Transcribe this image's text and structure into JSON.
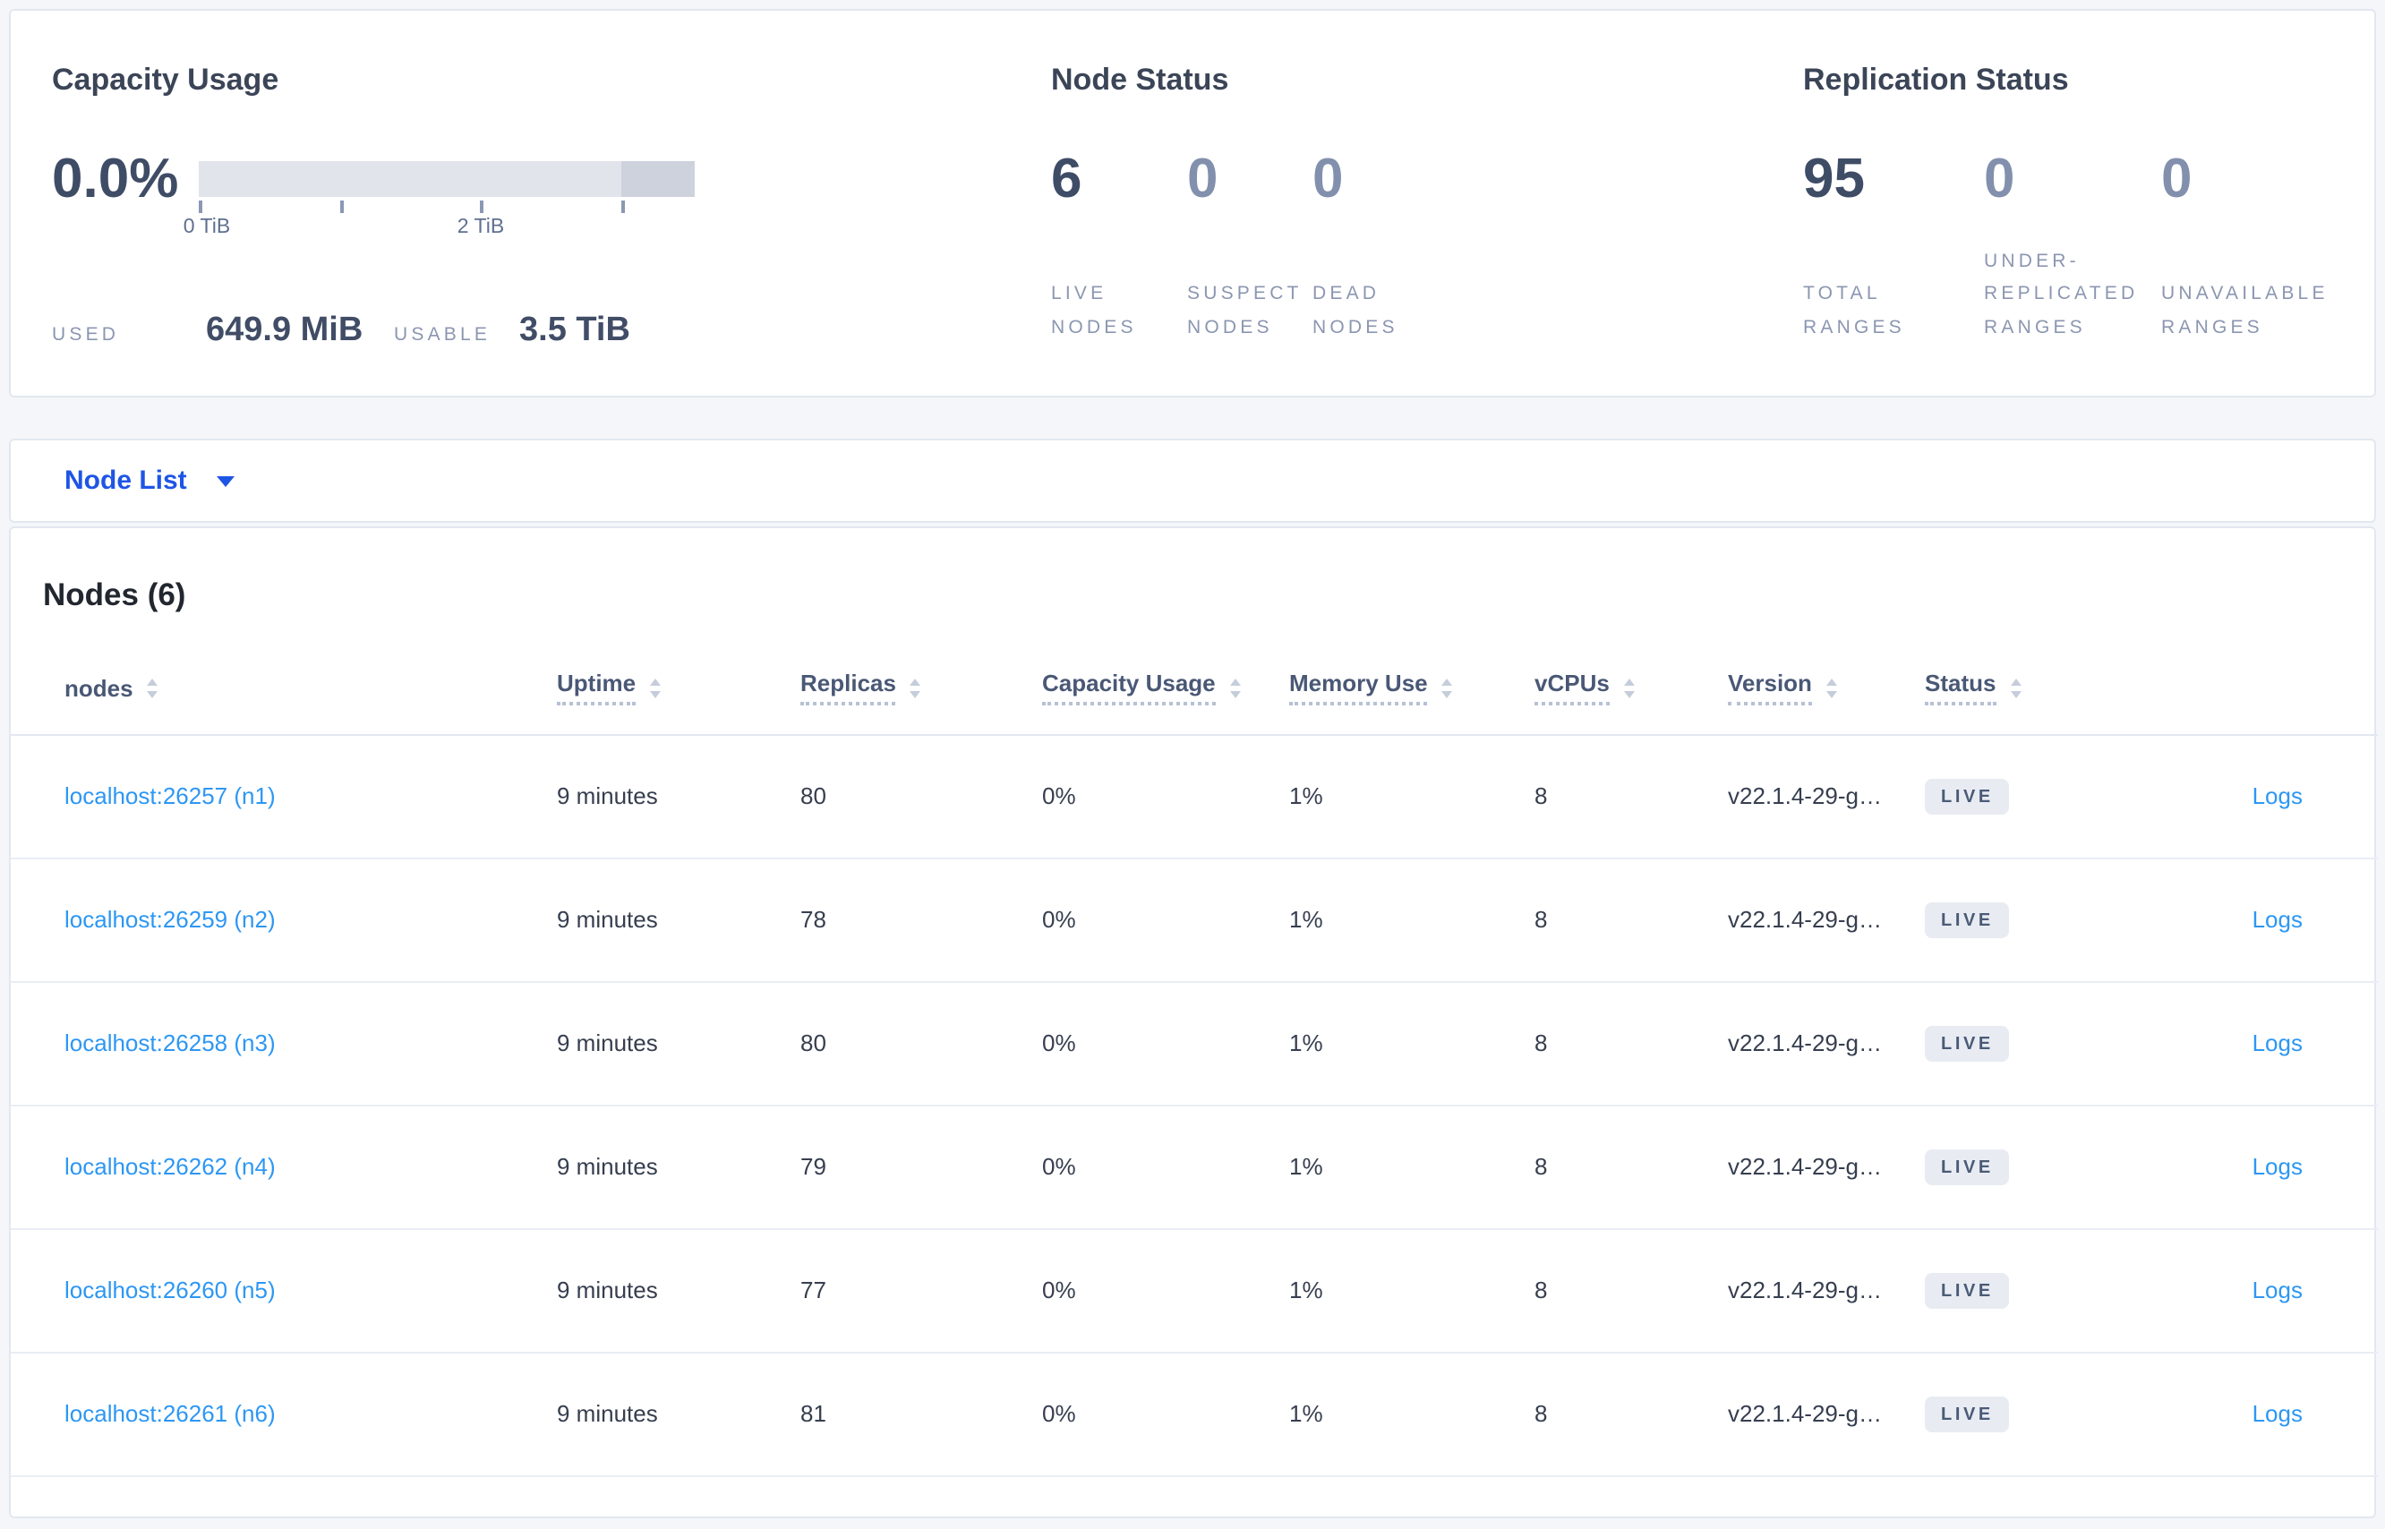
{
  "summary": {
    "capacity": {
      "title": "Capacity Usage",
      "percent": "0.0%",
      "gauge": {
        "axis_ticks_tib": [
          0,
          1,
          2,
          3
        ],
        "tick_labels": [
          "0 TiB",
          "2 TiB"
        ],
        "axis_max_tib": 3.5,
        "used_fraction": 0.0
      },
      "used_label": "USED",
      "used_value": "649.9 MiB",
      "usable_label": "USABLE",
      "usable_value": "3.5 TiB"
    },
    "node_status": {
      "title": "Node Status",
      "stats": [
        {
          "value": "6",
          "label": "LIVE\nNODES"
        },
        {
          "value": "0",
          "label": "SUSPECT\nNODES"
        },
        {
          "value": "0",
          "label": "DEAD\nNODES"
        }
      ]
    },
    "replication_status": {
      "title": "Replication Status",
      "stats": [
        {
          "value": "95",
          "label": "TOTAL\nRANGES"
        },
        {
          "value": "0",
          "label": "UNDER-\nREPLICATED\nRANGES"
        },
        {
          "value": "0",
          "label": "UNAVAILABLE\nRANGES"
        }
      ]
    }
  },
  "node_list_selector": {
    "label": "Node List"
  },
  "table": {
    "title": "Nodes (6)",
    "columns": [
      {
        "label": "nodes"
      },
      {
        "label": "Uptime"
      },
      {
        "label": "Replicas"
      },
      {
        "label": "Capacity Usage"
      },
      {
        "label": "Memory Use"
      },
      {
        "label": "vCPUs"
      },
      {
        "label": "Version"
      },
      {
        "label": "Status"
      },
      {
        "label": ""
      }
    ],
    "rows": [
      {
        "node": "localhost:26257 (n1)",
        "uptime": "9 minutes",
        "replicas": "80",
        "capacity": "0%",
        "memory": "1%",
        "vcpus": "8",
        "version": "v22.1.4-29-g…",
        "status": "LIVE",
        "logs": "Logs"
      },
      {
        "node": "localhost:26259 (n2)",
        "uptime": "9 minutes",
        "replicas": "78",
        "capacity": "0%",
        "memory": "1%",
        "vcpus": "8",
        "version": "v22.1.4-29-g…",
        "status": "LIVE",
        "logs": "Logs"
      },
      {
        "node": "localhost:26258 (n3)",
        "uptime": "9 minutes",
        "replicas": "80",
        "capacity": "0%",
        "memory": "1%",
        "vcpus": "8",
        "version": "v22.1.4-29-g…",
        "status": "LIVE",
        "logs": "Logs"
      },
      {
        "node": "localhost:26262 (n4)",
        "uptime": "9 minutes",
        "replicas": "79",
        "capacity": "0%",
        "memory": "1%",
        "vcpus": "8",
        "version": "v22.1.4-29-g…",
        "status": "LIVE",
        "logs": "Logs"
      },
      {
        "node": "localhost:26260 (n5)",
        "uptime": "9 minutes",
        "replicas": "77",
        "capacity": "0%",
        "memory": "1%",
        "vcpus": "8",
        "version": "v22.1.4-29-g…",
        "status": "LIVE",
        "logs": "Logs"
      },
      {
        "node": "localhost:26261 (n6)",
        "uptime": "9 minutes",
        "replicas": "81",
        "capacity": "0%",
        "memory": "1%",
        "vcpus": "8",
        "version": "v22.1.4-29-g…",
        "status": "LIVE",
        "logs": "Logs"
      }
    ]
  },
  "colors": {
    "link_blue": "#2d97f3",
    "selector_blue": "#1e55e5",
    "badge_bg": "#e8ecf2",
    "bar_light": "#e2e4eb",
    "bar_dark": "#ced2dd",
    "page_bg": "#f4f6fa"
  }
}
